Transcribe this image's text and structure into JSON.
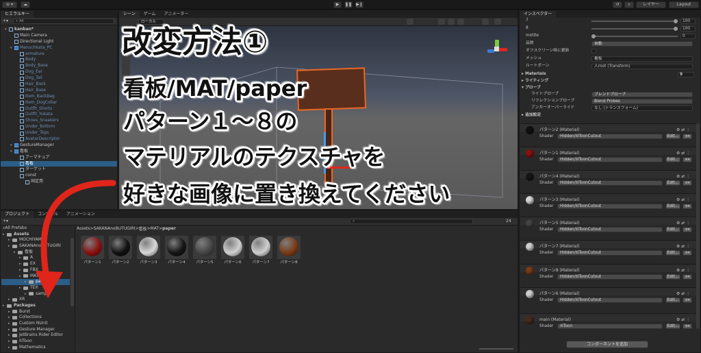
{
  "toolbar": {
    "account": "⊖ ▾",
    "cloud": "☁",
    "layers": "レイヤー",
    "layout": "Layout"
  },
  "hierarchy": {
    "tab": "ヒエラルキー",
    "search_placeholder": "All",
    "items": [
      {
        "label": "kanban*",
        "depth": 0,
        "kind": "scene"
      },
      {
        "label": "Main Camera",
        "depth": 1,
        "kind": "obj"
      },
      {
        "label": "Directional Light",
        "depth": 1,
        "kind": "obj"
      },
      {
        "label": "Manuchkata_PC",
        "depth": 1,
        "kind": "prefab",
        "dim": true
      },
      {
        "label": "armature",
        "depth": 2,
        "kind": "obj",
        "dim": true
      },
      {
        "label": "Body",
        "depth": 2,
        "kind": "obj",
        "dim": true
      },
      {
        "label": "Body_Base",
        "depth": 2,
        "kind": "obj",
        "dim": true
      },
      {
        "label": "Dog_Ear",
        "depth": 2,
        "kind": "obj",
        "dim": true
      },
      {
        "label": "Dog_Tail",
        "depth": 2,
        "kind": "obj",
        "dim": true
      },
      {
        "label": "Hair_Back",
        "depth": 2,
        "kind": "obj",
        "dim": true
      },
      {
        "label": "Hair_Base",
        "depth": 2,
        "kind": "obj",
        "dim": true
      },
      {
        "label": "Item_BackBag",
        "depth": 2,
        "kind": "obj",
        "dim": true
      },
      {
        "label": "Item_DogCollar",
        "depth": 2,
        "kind": "obj",
        "dim": true
      },
      {
        "label": "Outfit_Shorts",
        "depth": 2,
        "kind": "obj",
        "dim": true
      },
      {
        "label": "Outfit_Yukata",
        "depth": 2,
        "kind": "obj",
        "dim": true
      },
      {
        "label": "Shoes_Sneakers",
        "depth": 2,
        "kind": "obj",
        "dim": true
      },
      {
        "label": "Under_Bottom",
        "depth": 2,
        "kind": "obj",
        "dim": true
      },
      {
        "label": "Under_Tops",
        "depth": 2,
        "kind": "obj",
        "dim": true
      },
      {
        "label": "AvatarDescriptor",
        "depth": 2,
        "kind": "obj",
        "dim": true
      },
      {
        "label": "GestureManager",
        "depth": 1,
        "kind": "prefab"
      },
      {
        "label": "看板",
        "depth": 1,
        "kind": "prefab"
      },
      {
        "label": "アーマチュア",
        "depth": 2,
        "kind": "obj"
      },
      {
        "label": "看板",
        "depth": 2,
        "kind": "obj",
        "selected": true
      },
      {
        "label": "ターゲット",
        "depth": 2,
        "kind": "obj"
      },
      {
        "label": "const",
        "depth": 2,
        "kind": "obj"
      },
      {
        "label": "固定用",
        "depth": 3,
        "kind": "obj"
      }
    ]
  },
  "scene": {
    "tabs": [
      "シーン",
      "ゲーム",
      "アニメーター"
    ],
    "shading": "ローカル"
  },
  "inspector": {
    "tab": "インスペクター",
    "rows": [
      {
        "label": "7",
        "value": "100",
        "type": "slider"
      },
      {
        "label": "8",
        "value": "100",
        "type": "slider"
      },
      {
        "label": "motite",
        "value": "0",
        "type": "slider"
      },
      {
        "label": "品質",
        "value": "自動",
        "type": "dropdown"
      },
      {
        "label": "オフスクリーン時に更新",
        "value": "",
        "type": "checkbox"
      },
      {
        "label": "メッシュ",
        "value": "看板",
        "type": "object"
      },
      {
        "label": "ルートボーン",
        "value": "人root (Transform)",
        "type": "object"
      }
    ],
    "materials_label": "Materials",
    "materials_count": "9",
    "lighting_label": "ライティング",
    "probes_label": "プローブ",
    "probe_rows": [
      {
        "label": "ライトプローブ",
        "value": "ブレンドプローブ"
      },
      {
        "label": "リフレクションプローブ",
        "value": "Blend Probes"
      },
      {
        "label": "アンカーオーバーライド",
        "value": "なし (トランスフォーム)"
      }
    ],
    "additional_label": "追加設定",
    "shader_label": "Shader",
    "edit_label": "Edit...",
    "materials": [
      {
        "name": "パターン2 (Material)",
        "shader": "Hidden/lilToonCutout",
        "color": "#111111"
      },
      {
        "name": "パターン1 (Material)",
        "shader": "Hidden/lilToonCutout",
        "color": "#8a1010"
      },
      {
        "name": "パターン4 (Material)",
        "shader": "Hidden/lilToonCutout",
        "color": "#151515"
      },
      {
        "name": "パターン3 (Material)",
        "shader": "Hidden/lilToonCutout",
        "color": "#d8d8d8"
      },
      {
        "name": "パターン5 (Material)",
        "shader": "Hidden/lilToonCutout",
        "color": "#444444"
      },
      {
        "name": "パターン7 (Material)",
        "shader": "Hidden/lilToonCutout",
        "color": "#cfcfcf"
      },
      {
        "name": "パターン8 (Material)",
        "shader": "Hidden/lilToonCutout",
        "color": "#7a3a16"
      },
      {
        "name": "パターン6 (Material)",
        "shader": "Hidden/lilToonCutout",
        "color": "#d0d0d0"
      },
      {
        "name": "main (Material)",
        "shader": "lilToon",
        "color": "#4a2a1c"
      }
    ],
    "add_component": "コンポーネントを追加"
  },
  "project": {
    "tabs": [
      "プロジェクト",
      "コンソール",
      "アニメーション"
    ],
    "count": "24",
    "tree": [
      {
        "label": "All Prefabs",
        "depth": 0,
        "kind": "search"
      },
      {
        "label": "Assets",
        "depth": 0,
        "kind": "folder",
        "bold": true
      },
      {
        "label": "MOCHIYAMA",
        "depth": 1,
        "kind": "folder"
      },
      {
        "label": "SAKANAnoBUTUGIRI",
        "depth": 1,
        "kind": "folder"
      },
      {
        "label": "看板",
        "depth": 2,
        "kind": "folder"
      },
      {
        "label": "A",
        "depth": 3,
        "kind": "folder"
      },
      {
        "label": "EX",
        "depth": 3,
        "kind": "folder"
      },
      {
        "label": "FBX",
        "depth": 3,
        "kind": "folder"
      },
      {
        "label": "MAT",
        "depth": 3,
        "kind": "folder"
      },
      {
        "label": "paper",
        "depth": 4,
        "kind": "folder",
        "selected": true
      },
      {
        "label": "TEX",
        "depth": 3,
        "kind": "folder"
      },
      {
        "label": "sample",
        "depth": 4,
        "kind": "folder"
      },
      {
        "label": "XR",
        "depth": 1,
        "kind": "folder"
      },
      {
        "label": "Packages",
        "depth": 0,
        "kind": "folder",
        "bold": true
      },
      {
        "label": "Burst",
        "depth": 1,
        "kind": "folder"
      },
      {
        "label": "Collections",
        "depth": 1,
        "kind": "folder"
      },
      {
        "label": "Custom NUnit",
        "depth": 1,
        "kind": "folder"
      },
      {
        "label": "Gesture Manager",
        "depth": 1,
        "kind": "folder"
      },
      {
        "label": "JetBrains Rider Editor",
        "depth": 1,
        "kind": "folder"
      },
      {
        "label": "lilToon",
        "depth": 1,
        "kind": "folder"
      },
      {
        "label": "Mathematics",
        "depth": 1,
        "kind": "folder"
      }
    ],
    "breadcrumb": [
      "Assets",
      "SAKANAnoBUTUGIRI",
      "看板",
      "MAT",
      "paper"
    ],
    "assets": [
      {
        "label": "パターン1",
        "color": "#8a1010"
      },
      {
        "label": "パターン2",
        "color": "#111111"
      },
      {
        "label": "パターン3",
        "color": "#d8d8d8"
      },
      {
        "label": "パターン4",
        "color": "#151515"
      },
      {
        "label": "パターン5",
        "color": "#444444"
      },
      {
        "label": "パターン6",
        "color": "#d0d0d0"
      },
      {
        "label": "パターン7",
        "color": "#cfcfcf"
      },
      {
        "label": "パターン8",
        "color": "#7a3a16"
      }
    ]
  },
  "overlay": {
    "title": "改変方法①",
    "lines": [
      "看板/MAT/paper",
      "パターン１～８の",
      "マテリアルのテクスチャを",
      "好きな画像に置き換えてください"
    ]
  },
  "colors": {
    "accent": "#2c5d87",
    "arrow": "#e0251b",
    "plank": "#5a2e1c",
    "outline": "#e8692a"
  }
}
